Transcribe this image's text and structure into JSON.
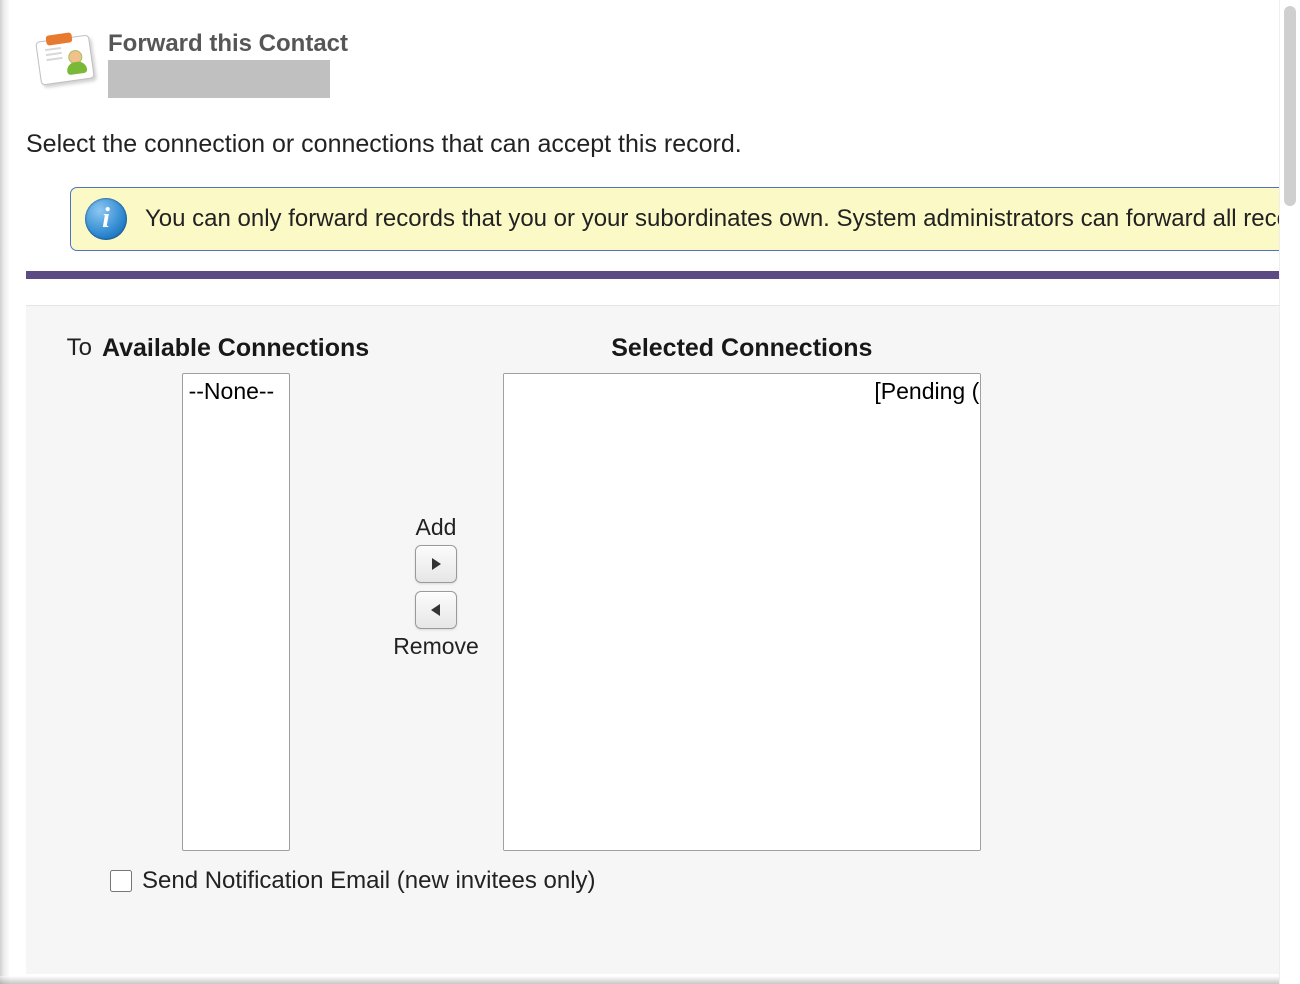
{
  "header": {
    "title": "Forward this Contact",
    "record_name": ""
  },
  "instruction": "Select the connection or connections that can accept this record.",
  "info_banner": {
    "icon_char": "i",
    "text": "You can only forward records that you or your subordinates own. System administrators can forward all records."
  },
  "picker": {
    "to_label": "To",
    "available_heading": "Available Connections",
    "selected_heading": "Selected Connections",
    "available_options": [
      "--None--"
    ],
    "selected_options": [
      {
        "name_redacted": true,
        "status_suffix": "[Pending (sent)]"
      }
    ],
    "add_label": "Add",
    "remove_label": "Remove"
  },
  "notify": {
    "checked": false,
    "label": "Send Notification Email (new invitees only)"
  }
}
